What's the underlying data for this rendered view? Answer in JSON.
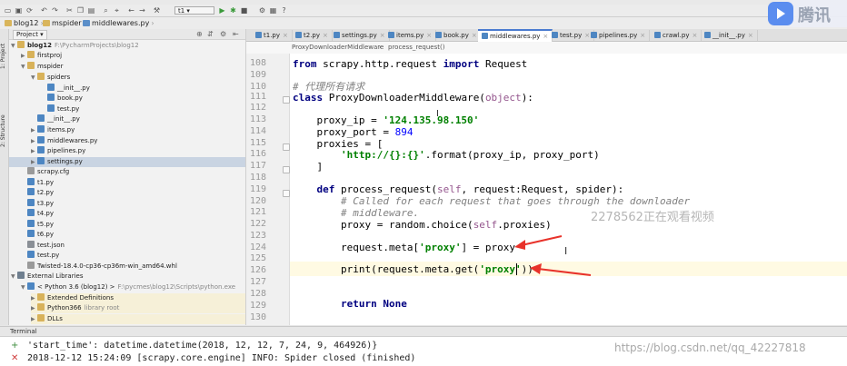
{
  "toolbar": {
    "run_config": "t1"
  },
  "navbar": {
    "crumbs": [
      "blog12",
      "mspider",
      "middlewares.py"
    ]
  },
  "left_strip": {
    "project_label": "1: Project",
    "structure_label": "2: Structure"
  },
  "project": {
    "view_select": "Project",
    "tree": [
      {
        "label": "blog12",
        "note": "F:\\PycharmProjects\\blog12"
      },
      {
        "label": "firstproj"
      },
      {
        "label": "mspider"
      },
      {
        "label": "spiders"
      },
      {
        "label": "__init__.py"
      },
      {
        "label": "book.py"
      },
      {
        "label": "test.py"
      },
      {
        "label": "__init__.py"
      },
      {
        "label": "items.py"
      },
      {
        "label": "middlewares.py"
      },
      {
        "label": "pipelines.py"
      },
      {
        "label": "settings.py"
      },
      {
        "label": "scrapy.cfg"
      },
      {
        "label": "t1.py"
      },
      {
        "label": "t2.py"
      },
      {
        "label": "t3.py"
      },
      {
        "label": "t4.py"
      },
      {
        "label": "t5.py"
      },
      {
        "label": "t6.py"
      },
      {
        "label": "test.json"
      },
      {
        "label": "test.py"
      },
      {
        "label": "Twisted-18.4.0-cp36-cp36m-win_amd64.whl"
      },
      {
        "label": "External Libraries"
      },
      {
        "label": "< Python 3.6 (blog12) >",
        "note": "F:\\pycmes\\blog12\\Scripts\\python.exe"
      },
      {
        "label": "Extended Definitions"
      },
      {
        "label": "Python366",
        "note": "library root"
      },
      {
        "label": "DLLs"
      }
    ]
  },
  "tabs": [
    "t1.py",
    "t2.py",
    "settings.py",
    "items.py",
    "book.py",
    "middlewares.py",
    "test.py",
    "pipelines.py",
    "crawl.py",
    "__init__.py"
  ],
  "editor": {
    "breadcrumb": [
      "ProxyDownloaderMiddleware",
      "process_request()"
    ],
    "line_numbers": [
      "108",
      "109",
      "110",
      "111",
      "112",
      "113",
      "114",
      "115",
      "116",
      "117",
      "118",
      "119",
      "120",
      "121",
      "122",
      "123",
      "124",
      "125",
      "126",
      "127",
      "128",
      "129",
      "130"
    ],
    "code": {
      "l108a": "from",
      "l108b": " scrapy.http.request ",
      "l108c": "import",
      "l108d": " Request",
      "l110": "# 代理所有请求",
      "l111a": "class",
      "l111b": " ProxyDownloaderMiddleware(",
      "l111c": "object",
      "l111d": "):",
      "l113a": "    proxy_ip = ",
      "l113b": "'124.135.98.150'",
      "l114a": "    proxy_port = ",
      "l114b": "894",
      "l115": "    proxies = [",
      "l116a": "        ",
      "l116b": "'http://{}:{}'",
      "l116c": ".format(proxy_ip, proxy_port)",
      "l117": "    ]",
      "l119a": "    ",
      "l119b": "def",
      "l119c": " process_request(",
      "l119d": "self",
      "l119e": ", request:Request, spider):",
      "l120": "        # Called for each request that goes through the downloader",
      "l121": "        # middleware.",
      "l122a": "        proxy = random.choice(",
      "l122b": "self",
      "l122c": ".proxies)",
      "l124a": "        request.meta[",
      "l124b": "'proxy'",
      "l124c": "] = proxy",
      "l126a": "        print(request.meta.get(",
      "l126b": "'proxy'",
      "l126c": "))",
      "l129a": "        ",
      "l129b": "return",
      "l129c": " ",
      "l129d": "None"
    }
  },
  "overlay": {
    "live_watermark": "2278562正在观看视频",
    "csdn": "https://blog.csdn.net/qq_42227818",
    "tencent": "腾讯"
  },
  "terminal": {
    "title": "Terminal",
    "lines": [
      "'start_time': datetime.datetime(2018, 12, 12, 7, 24, 9, 464926)}",
      "2018-12-12 15:24:09 [scrapy.core.engine] INFO: Spider closed (finished)"
    ]
  },
  "colors": {
    "accent": "#4a7bd0",
    "arrow": "#e8322a",
    "keyword": "#000080",
    "string": "#008000"
  }
}
